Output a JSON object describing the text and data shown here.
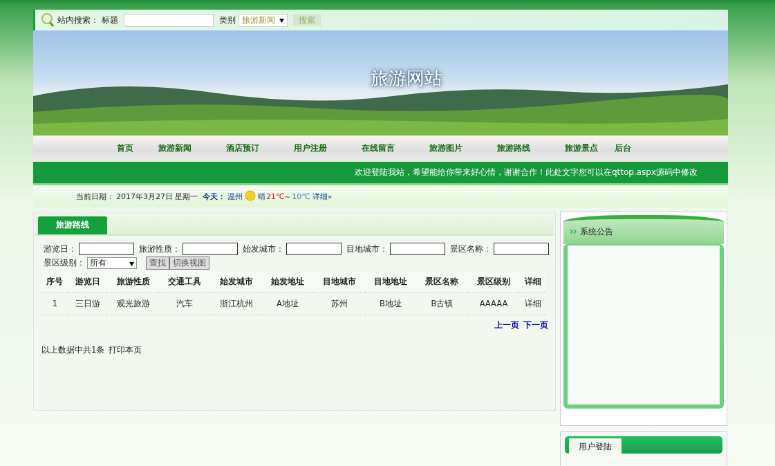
{
  "search_bar": {
    "label": "站内搜索：",
    "title_label": "标题",
    "category_label": "类别",
    "category_value": "旅游新闻",
    "button": "搜索"
  },
  "banner": {
    "title": "旅游网站"
  },
  "nav": [
    {
      "label": "首页"
    },
    {
      "label": "旅游新闻"
    },
    {
      "label": "酒店预订"
    },
    {
      "label": "用户注册"
    },
    {
      "label": "在线留言"
    },
    {
      "label": "旅游图片"
    },
    {
      "label": "旅游路线"
    },
    {
      "label": "旅游景点"
    },
    {
      "label": "后台"
    }
  ],
  "marquee": "欢迎登陆我站，希望能给你带来好心情，谢谢合作！此处文字您可以在qttop.aspx源码中修改",
  "date_bar": {
    "date_label": "当前日期：",
    "date": "2017年3月27日",
    "weekday": "星期一",
    "today_label": "今天：",
    "city": "温州",
    "weather": "晴",
    "high": "21℃",
    "sep": "～",
    "low": "10℃",
    "details": "详细»"
  },
  "main_panel": {
    "tab": "旅游路线",
    "filters": [
      {
        "label": "游览日："
      },
      {
        "label": "旅游性质："
      },
      {
        "label": "始发城市："
      },
      {
        "label": "目地城市："
      },
      {
        "label": "景区名称："
      }
    ],
    "level_filter": {
      "label": "景区级别：",
      "value": "所有"
    },
    "buttons": [
      "查找",
      "切换视图"
    ],
    "table": {
      "columns": [
        "序号",
        "游览日",
        "旅游性质",
        "交通工具",
        "始发城市",
        "始发地址",
        "目地城市",
        "目地地址",
        "景区名称",
        "景区级别",
        "详细"
      ],
      "rows": [
        [
          "1",
          "三日游",
          "观光旅游",
          "汽车",
          "浙江杭州",
          "A地址",
          "苏州",
          "B地址",
          "B古镇",
          "AAAAA",
          "详细"
        ]
      ]
    },
    "pager": [
      "上一页",
      "下一页"
    ],
    "summary": "以上数据中共1条",
    "print": "打印本页"
  },
  "notice_panel": {
    "title": "系统公告"
  },
  "login_panel": {
    "title": "用户登陆"
  }
}
